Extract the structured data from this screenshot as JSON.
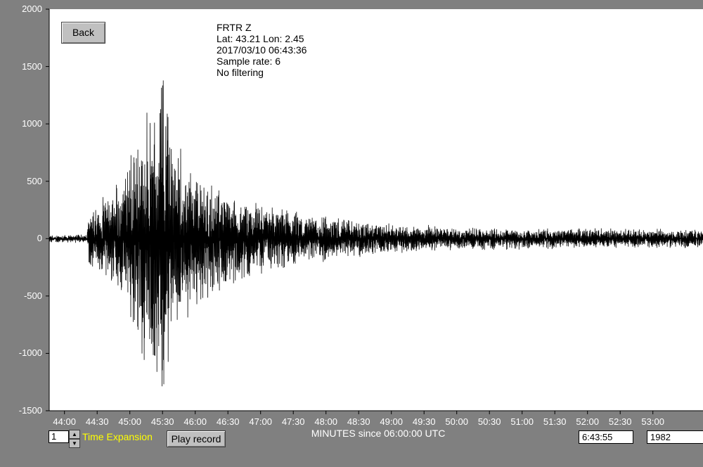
{
  "chart_data": {
    "type": "line",
    "xlabel": "MINUTES since 06:00:00 UTC",
    "ylabel": "",
    "ylim": [
      -1500,
      2000
    ],
    "xlim": [
      "43:46",
      "53:46"
    ],
    "y_ticks": [
      "2000",
      "1500",
      "1000",
      "500",
      "0",
      "-500",
      "-1000",
      "-1500"
    ],
    "x_ticks": [
      "44:00",
      "44:30",
      "45:00",
      "45:30",
      "46:00",
      "46:30",
      "47:00",
      "47:30",
      "48:00",
      "48:30",
      "49:00",
      "49:30",
      "50:00",
      "50:30",
      "51:00",
      "51:30",
      "52:00",
      "52:30",
      "53:00"
    ],
    "series": [
      {
        "color": "#000000",
        "envelope": {
          "minutes": [
            "43:46",
            "44:20",
            "44:24",
            "44:30",
            "44:45",
            "45:00",
            "45:10",
            "45:20",
            "45:30",
            "45:40",
            "46:00",
            "46:20",
            "46:40",
            "47:00",
            "47:30",
            "48:00",
            "48:30",
            "49:00",
            "50:00",
            "51:00",
            "52:00",
            "53:00",
            "53:46"
          ],
          "peak_amplitude": [
            40,
            40,
            380,
            320,
            480,
            750,
            1150,
            1250,
            1650,
            1000,
            650,
            520,
            420,
            330,
            270,
            220,
            180,
            140,
            110,
            100,
            95,
            95,
            95
          ]
        }
      }
    ]
  },
  "station": {
    "name": "FRTR  Z",
    "location": "Lat: 43.21 Lon: 2.45",
    "datetime": "2017/03/10 06:43:36",
    "sample_rate": "Sample rate: 6",
    "filter": "No filtering"
  },
  "controls": {
    "back_label": "Back",
    "expansion_value": "1",
    "time_expansion_label": "Time Expansion",
    "play_label": "Play record",
    "time_value": "6:43:55",
    "year_value": "1982",
    "spin_up": "▲",
    "spin_down": "▼"
  }
}
